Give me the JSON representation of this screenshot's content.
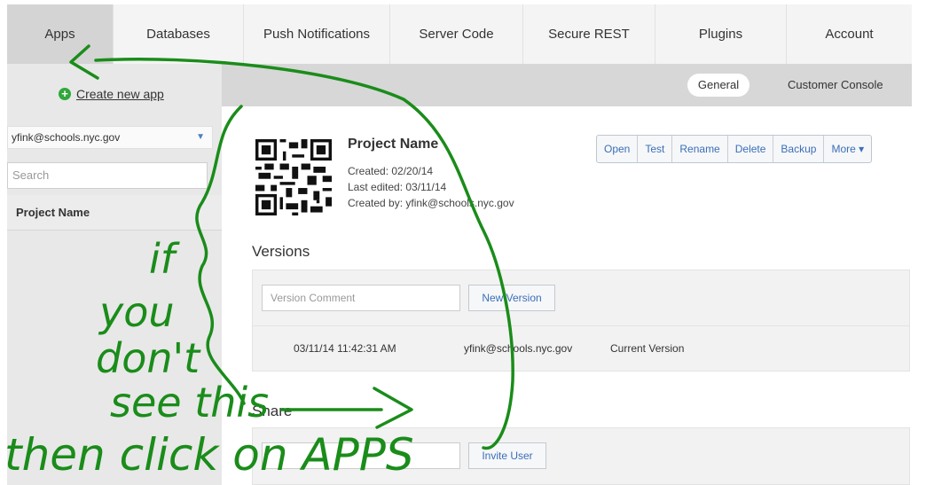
{
  "topnav": {
    "tabs": [
      {
        "label": "Apps"
      },
      {
        "label": "Databases"
      },
      {
        "label": "Push Notifications"
      },
      {
        "label": "Server Code"
      },
      {
        "label": "Secure REST"
      },
      {
        "label": "Plugins"
      },
      {
        "label": "Account"
      }
    ]
  },
  "sidebar": {
    "create_label": "Create new app",
    "account": "yfink@schools.nyc.gov",
    "search_placeholder": "Search",
    "project_item": "Project Name"
  },
  "subbar": {
    "general": "General",
    "console": "Customer Console"
  },
  "project": {
    "name": "Project Name",
    "created": "Created:    02/20/14",
    "edited": "Last edited: 03/11/14",
    "created_by": "Created by: yfink@schools.nyc.gov",
    "buttons": [
      "Open",
      "Test",
      "Rename",
      "Delete",
      "Backup",
      "More ▾"
    ]
  },
  "versions": {
    "title": "Versions",
    "comment_placeholder": "Version Comment",
    "new_version": "New Version",
    "row": {
      "date": "03/11/14 11:42:31 AM",
      "user": "yfink@schools.nyc.gov",
      "status": "Current Version"
    }
  },
  "share": {
    "title": "Share",
    "invite_label": "Invite User"
  },
  "annotation": {
    "lines": [
      "if",
      "you",
      "don't",
      "see this",
      "then click on APPS"
    ],
    "color": "#1a8c1a"
  },
  "colors": {
    "accent": "#3a6fb8",
    "create_icon": "#2fa83a"
  }
}
